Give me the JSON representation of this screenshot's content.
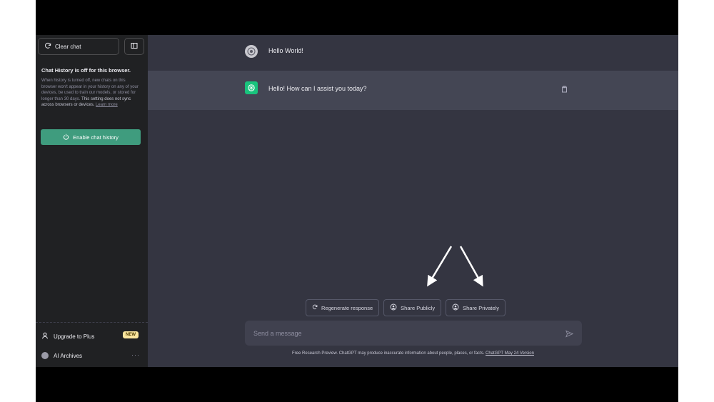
{
  "sidebar": {
    "clear_chat_label": "Clear chat",
    "history_off_title": "Chat History is off for this browser.",
    "history_off_body": "When history is turned off, new chats on this browser won't appear in your history on any of your devices, be used to train our models, or stored for longer than 30 days.",
    "history_off_strong": "This setting does not sync across browsers or devices.",
    "learn_more": "Learn more",
    "enable_history_label": "Enable chat history",
    "upgrade_label": "Upgrade to Plus",
    "upgrade_badge": "NEW",
    "archives_label": "AI Archives",
    "more_label": "···"
  },
  "conversation": {
    "user_message": "Hello World!",
    "assistant_message": "Hello! How can I assist you today?"
  },
  "actions": {
    "regenerate_label": "Regenerate response",
    "share_public_label": "Share Publicly",
    "share_private_label": "Share Privately"
  },
  "composer": {
    "placeholder": "Send a message"
  },
  "footer": {
    "text": "Free Research Preview. ChatGPT may produce inaccurate information about people, places, or facts.",
    "version_link": "ChatGPT May 24 Version"
  },
  "colors": {
    "sidebar_bg": "#202123",
    "main_bg": "#343541",
    "assistant_bg": "#444654",
    "accent_green": "#3f9c7e",
    "badge_yellow": "#fae69e"
  }
}
